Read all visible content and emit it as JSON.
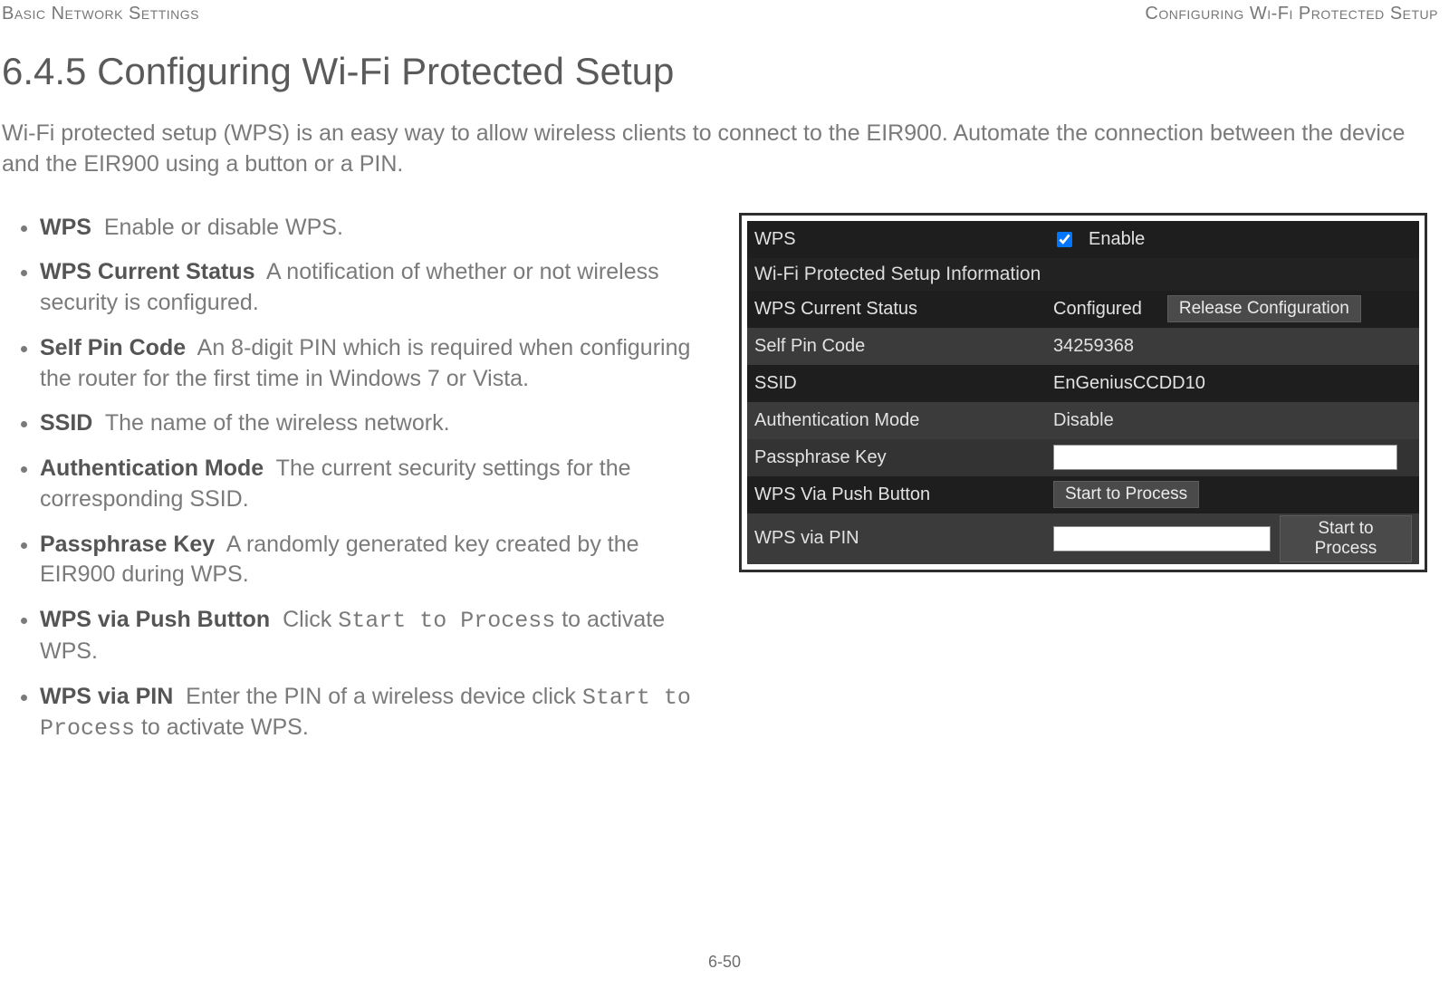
{
  "header": {
    "left": "Basic Network Settings",
    "right": "Configuring Wi-Fi Protected Setup"
  },
  "title": "6.4.5 Configuring Wi-Fi Protected Setup",
  "intro": "Wi-Fi protected setup (WPS) is an easy way to allow wireless clients to connect to the EIR900. Automate the connection between the device and the EIR900 using a button or a PIN.",
  "defs": {
    "wps": {
      "term": "WPS",
      "desc": "Enable or disable WPS."
    },
    "status": {
      "term": "WPS Current Status",
      "desc": "A notification of whether or not wireless security is configured."
    },
    "pin": {
      "term": "Self Pin Code",
      "desc": "An 8-digit PIN which is required when configuring the router for the first time in Windows 7 or Vista."
    },
    "ssid": {
      "term": "SSID",
      "desc": "The name of the wireless network."
    },
    "auth": {
      "term": "Authentication Mode",
      "desc": "The current security settings for the corresponding SSID."
    },
    "pass": {
      "term": "Passphrase Key",
      "desc": "A randomly generated key created by the EIR900 during WPS."
    },
    "push": {
      "term": "WPS via Push Button",
      "pre": "Click ",
      "code": "Start to Process",
      "post": " to activate WPS."
    },
    "viapin": {
      "term": "WPS via PIN",
      "pre": "Enter the PIN of a wireless device click ",
      "code": "Start to Process",
      "post": " to activate WPS."
    }
  },
  "panel": {
    "wps_label": "WPS",
    "enable_label": "Enable",
    "enable_checked": "true",
    "section_title": "Wi-Fi Protected Setup Information",
    "status_label": "WPS Current Status",
    "status_value": "Configured",
    "release_btn": "Release Configuration",
    "pin_label": "Self Pin Code",
    "pin_value": "34259368",
    "ssid_label": "SSID",
    "ssid_value": "EnGeniusCCDD10",
    "auth_label": "Authentication Mode",
    "auth_value": "Disable",
    "pass_label": "Passphrase Key",
    "pass_value": "",
    "push_label": "WPS Via Push Button",
    "push_btn": "Start to Process",
    "pin_method_label": "WPS via PIN",
    "pin_input_value": "",
    "pin_btn": "Start to Process"
  },
  "page_number": "6-50"
}
